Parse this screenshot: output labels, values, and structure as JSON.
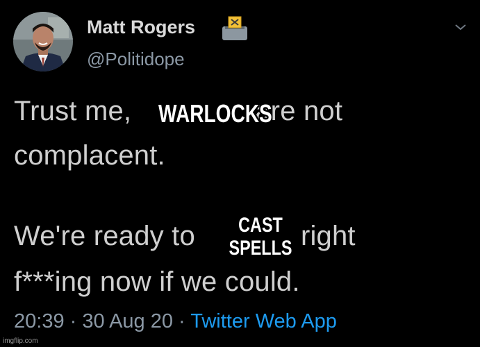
{
  "tweet": {
    "author": {
      "display_name": "Matt Rogers",
      "handle": "@Politidope",
      "badge_icon": "ballot-box-icon"
    },
    "menu_icon": "chevron-down-icon",
    "text_lines": {
      "line1_before": "Trust me,",
      "line1_after": "are not",
      "line2": "complacent.",
      "line3_before": "We're ready to",
      "line3_after": "right",
      "line4": "f***ing now if we could."
    },
    "meta": {
      "time": "20:39",
      "separator": " · ",
      "date": "30 Aug 20",
      "source": "Twitter Web App"
    }
  },
  "meme_overlay": {
    "caption_1": "WARLOCKS",
    "caption_2_line1": "CAST",
    "caption_2_line2": "SPELLS"
  },
  "watermark": "imgflip.com",
  "colors": {
    "background": "#000000",
    "name": "#d9d9d9",
    "body_text": "#cfcfcf",
    "secondary": "#8b98a5",
    "link": "#1d9bf0"
  }
}
